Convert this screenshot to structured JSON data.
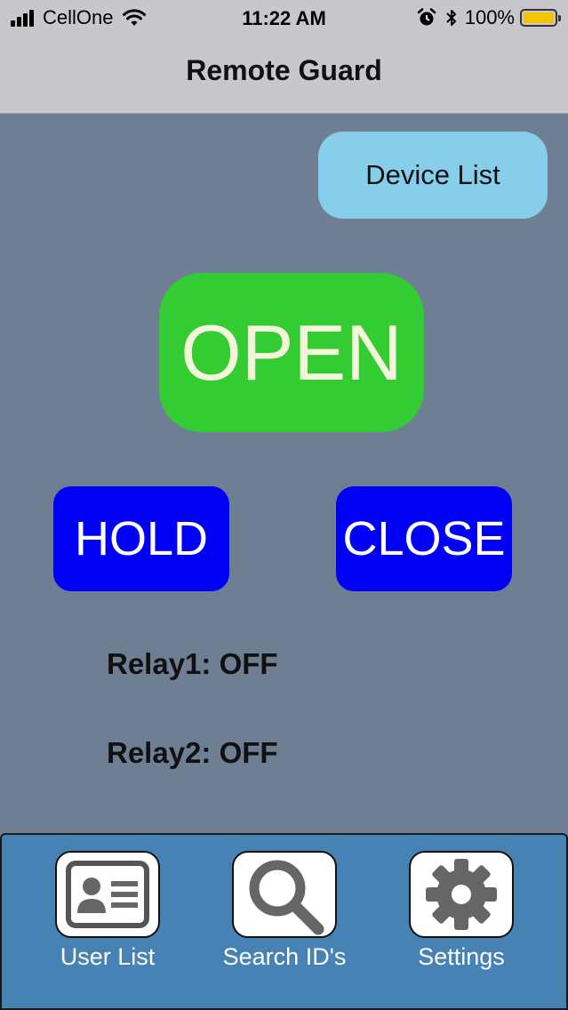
{
  "status_bar": {
    "carrier": "CellOne",
    "time": "11:22 AM",
    "battery": "100%",
    "battery_level": 1.0
  },
  "nav": {
    "title": "Remote Guard"
  },
  "buttons": {
    "device_list": "Device List",
    "open": "OPEN",
    "hold": "HOLD",
    "close": "CLOSE"
  },
  "relays": {
    "relay1": "Relay1: OFF",
    "relay2": "Relay2: OFF"
  },
  "tabs": [
    {
      "label": "User List",
      "icon": "contact-card-icon"
    },
    {
      "label": "Search ID's",
      "icon": "search-icon"
    },
    {
      "label": "Settings",
      "icon": "gear-icon"
    }
  ],
  "colors": {
    "background": "#6e7f93",
    "open": "#33cc33",
    "hold_close": "#0000f5",
    "device_list": "#87ceeb",
    "tab_bar": "#4682b4"
  }
}
